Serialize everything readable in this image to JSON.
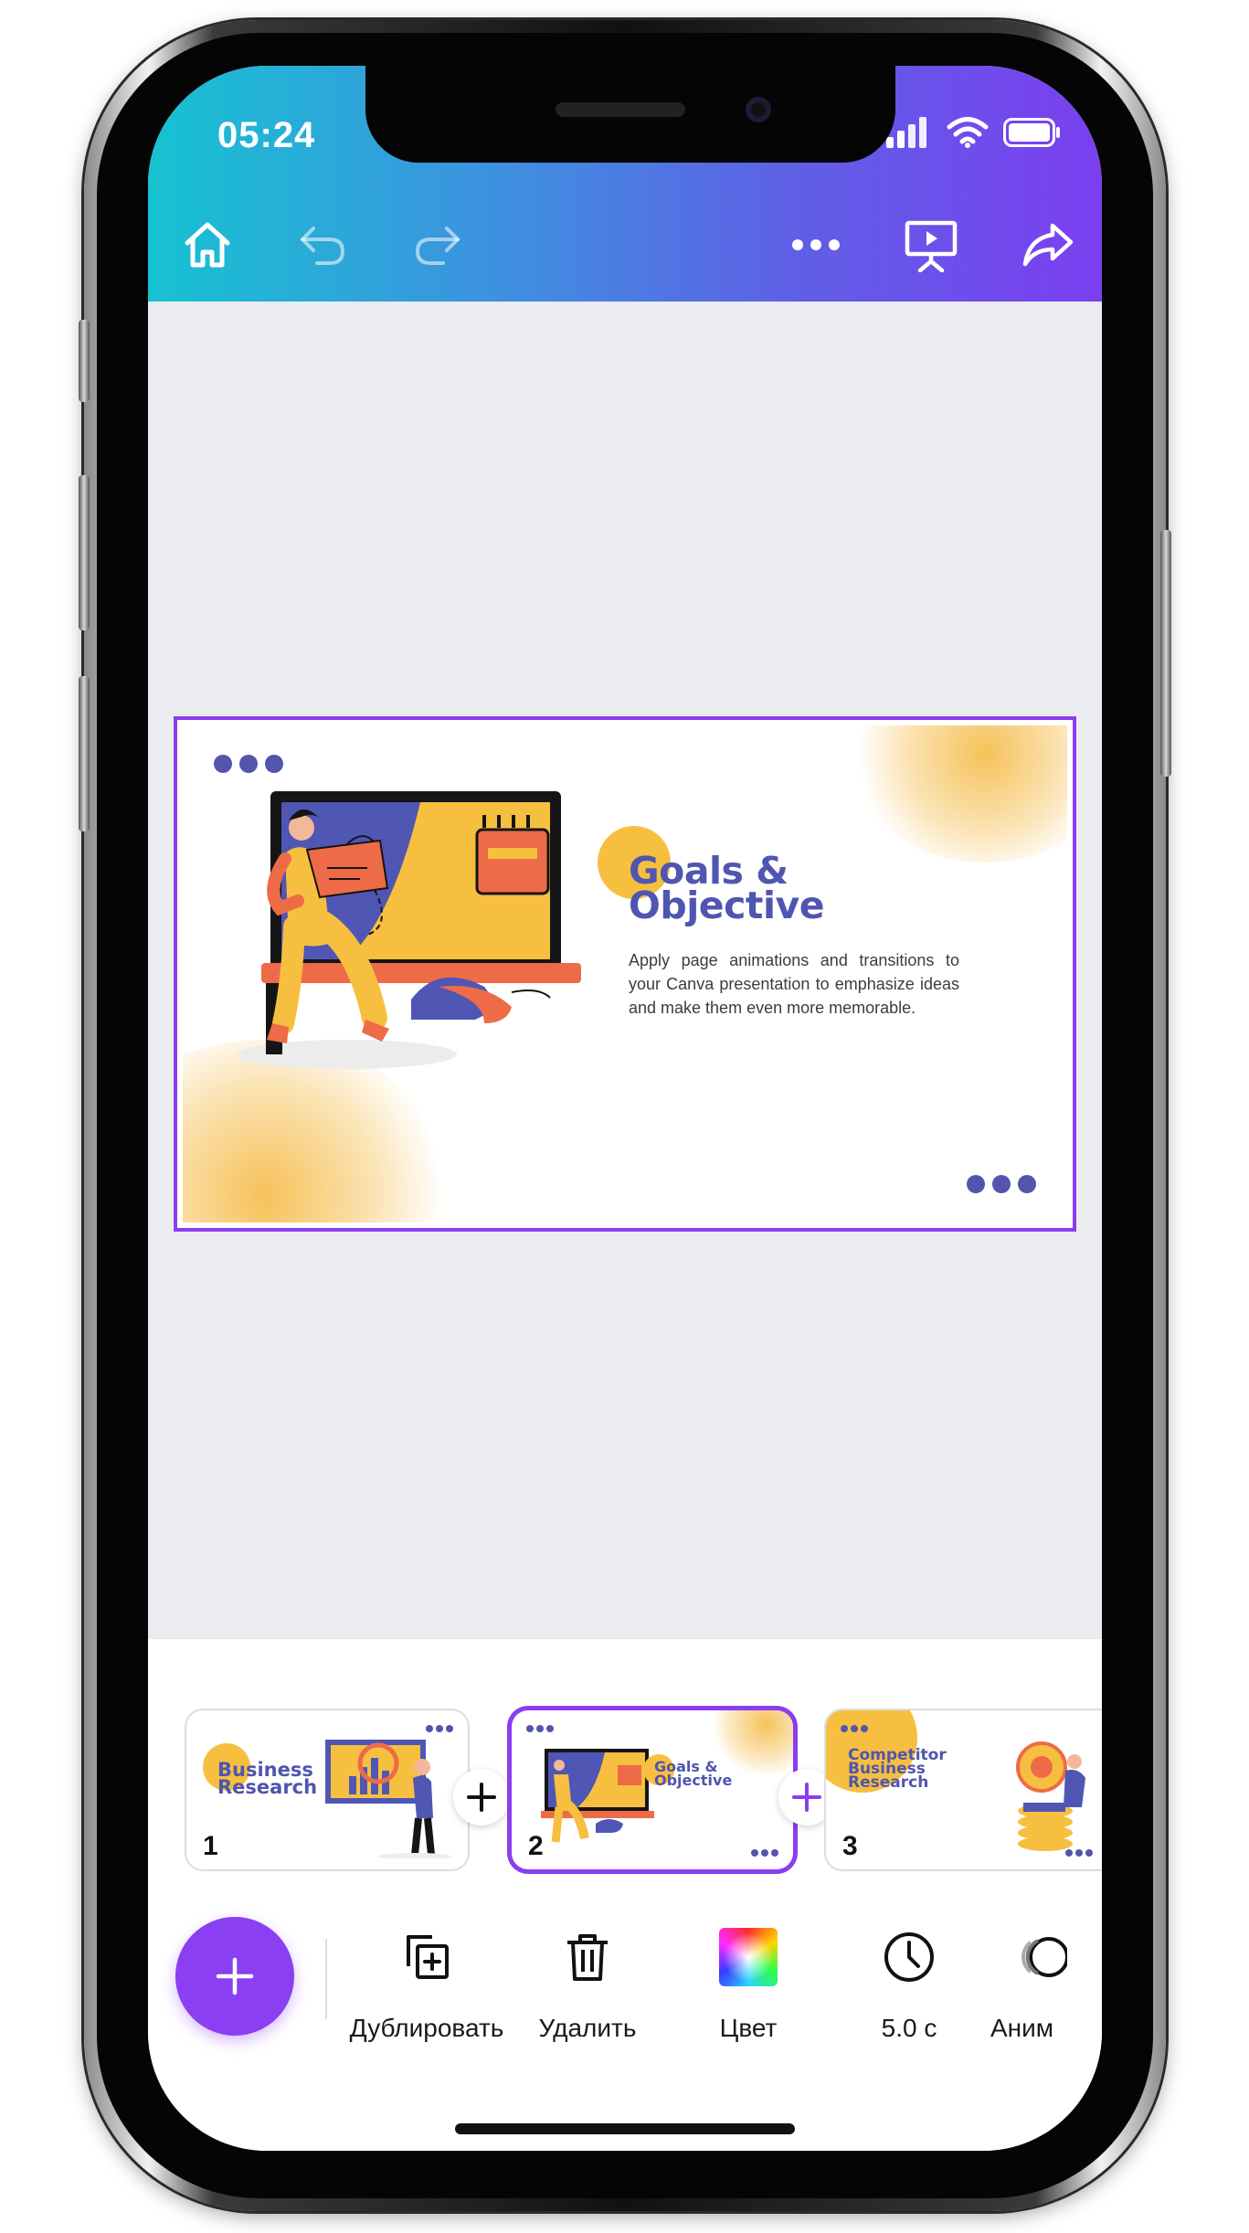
{
  "status_bar": {
    "time": "05:24"
  },
  "slide": {
    "title": "Goals & Objective",
    "body": "Apply page animations and transitions to your Canva presentation to emphasize ideas and make them even more memorable."
  },
  "thumbnails": [
    {
      "number": "1",
      "title": "Business Research",
      "active": false
    },
    {
      "number": "2",
      "title": "Goals & Objective",
      "active": true
    },
    {
      "number": "3",
      "title": "Competitor Business Research",
      "active": false
    }
  ],
  "bottom_toolbar": {
    "duplicate_label": "Дублировать",
    "delete_label": "Удалить",
    "color_label": "Цвет",
    "duration_label": "5.0 с",
    "animate_label": "Аним"
  },
  "colors": {
    "accent": "#8b3df0",
    "brand_gradient_start": "#17c2d2",
    "brand_gradient_end": "#7b3ff0",
    "slide_title": "#4f55b0",
    "slide_yellow": "#f7bf3f"
  },
  "icons": {
    "toolbar": [
      "home-icon",
      "undo-icon",
      "redo-icon",
      "more-icon",
      "present-icon",
      "share-icon"
    ],
    "status": [
      "signal-icon",
      "wifi-icon",
      "battery-icon"
    ]
  }
}
